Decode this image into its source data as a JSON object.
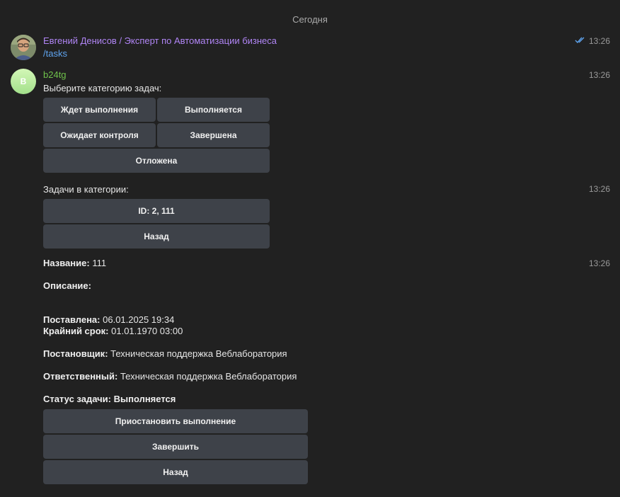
{
  "date_separator": "Сегодня",
  "user_message": {
    "sender": "Евгений Денисов / Эксперт по Автоматизации бизнеса",
    "text": "/tasks",
    "time": "13:26"
  },
  "bot_name": "b24tg",
  "bot_avatar_letter": "B",
  "messages": {
    "categories": {
      "prompt": "Выберите категорию задач:",
      "time": "13:26",
      "buttons": [
        "Ждет выполнения",
        "Выполняется",
        "Ожидает контроля",
        "Завершена",
        "Отложена"
      ]
    },
    "task_list": {
      "prompt": "Задачи в категории:",
      "time": "13:26",
      "buttons": [
        "ID: 2, 111",
        "Назад"
      ]
    },
    "task_detail": {
      "time": "13:26",
      "name_label": "Название:",
      "name_value": "111",
      "desc_label": "Описание:",
      "created_label": "Поставлена:",
      "created_value": "06.01.2025 19:34",
      "deadline_label": "Крайний срок:",
      "deadline_value": "01.01.1970 03:00",
      "creator_label": "Постановщик:",
      "creator_value": "Техническая поддержка Веблаборатория",
      "responsible_label": "Ответственный:",
      "responsible_value": "Техническая поддержка Веблаборатория",
      "status_label": "Статус задачи:",
      "status_value": "Выполняется",
      "buttons": [
        "Приостановить выполнение",
        "Завершить",
        "Назад"
      ]
    }
  }
}
